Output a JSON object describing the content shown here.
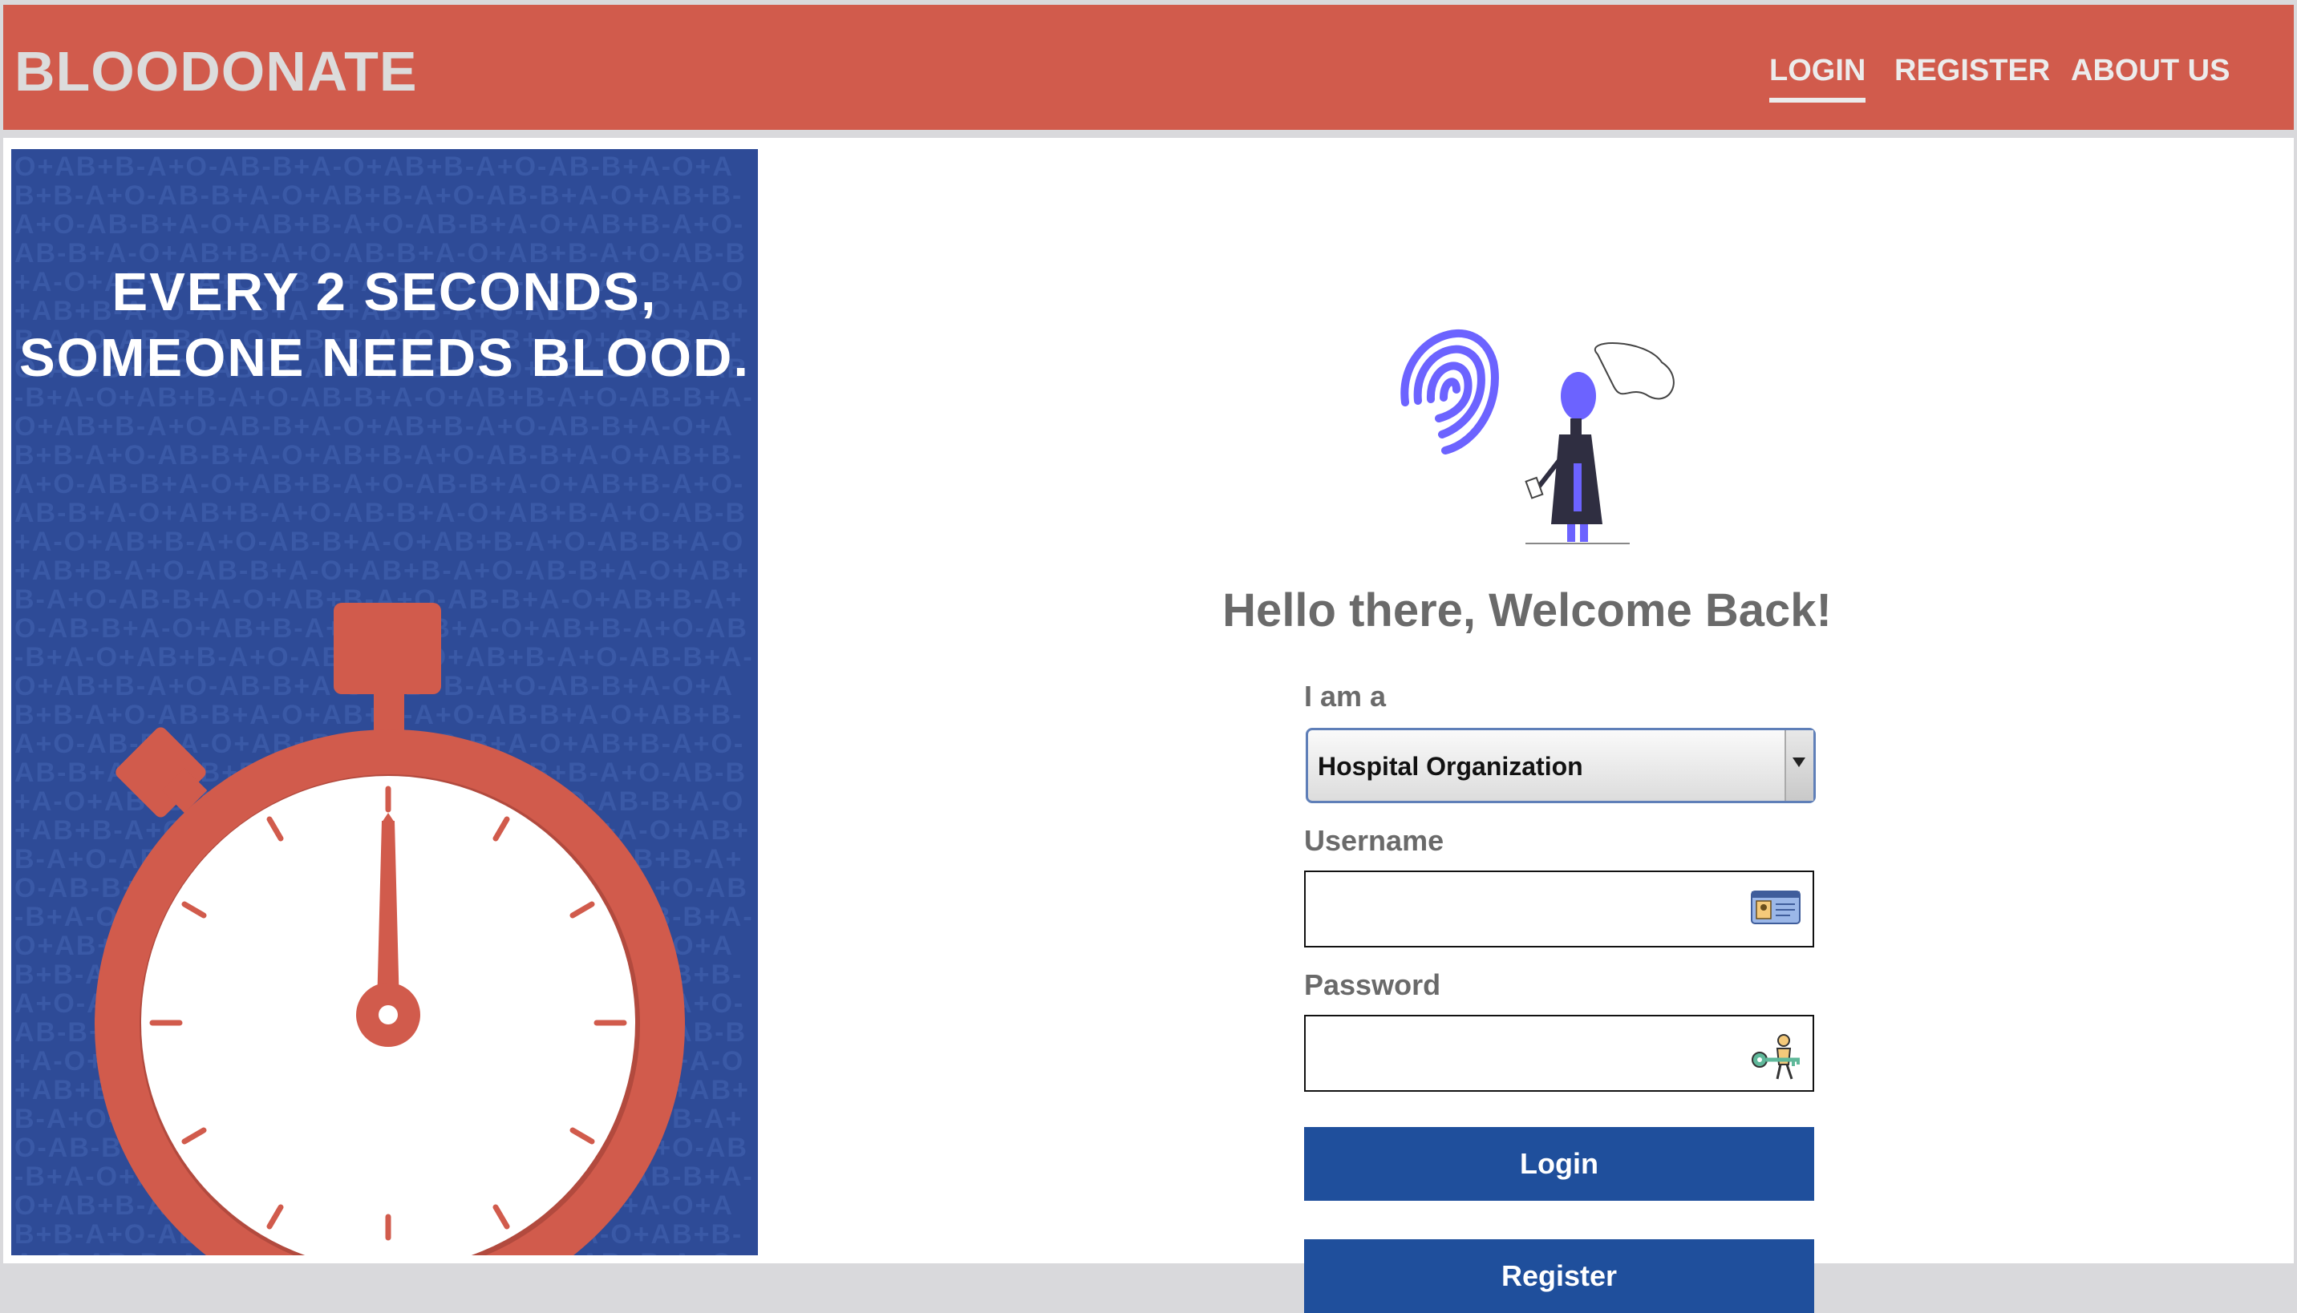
{
  "navbar": {
    "brand": "BLOODONATE",
    "links": [
      {
        "label": "LOGIN",
        "active": true
      },
      {
        "label": "REGISTER",
        "active": false
      },
      {
        "label": "ABOUT US",
        "active": false
      }
    ],
    "bg_color": "#d15b4c"
  },
  "poster": {
    "line1": "EVERY 2 SECONDS,",
    "line2": "SOMEONE NEEDS BLOOD.",
    "pattern_text": "O+AB+B-A+O-AB-B+A-O+AB+B-A+O-AB-B+A-O+AB+B-A+O-AB-B+A-O+AB+B-A+O-AB-B+A-O+AB+B-A+O-AB-B+A-O+AB+B-A+O-AB-B+A-O+AB+B-A+O-AB-B+A-O+AB+B-A+O-AB-B+A-O+AB+B-A+O-AB-B+A-O+AB+B-A+O-AB-B+A-O+AB+B-A+O-AB-B+A-O+AB+B-A+O-AB-B+A-O+AB+B-A+O-AB-B+A-O+AB+B-A+O-AB-B+A-O+AB+B-A+O-AB-B+A-O+AB+B-A+O-AB-B+A-O+AB+B-A+O-AB-B+A-O+AB+B-A+O-AB-B+A-O+AB+B-A+O-AB-B+A-O+AB+B-A+O-AB-B+A-O+AB+B-A+O-AB-B+A-O+AB+B-A+O-AB-B+A-O+AB+B-A+O-AB-B+A-O+AB+B-A+O-AB-B+A-O+AB+B-A+O-AB-B+A-O+AB+B-A+O-AB-B+A-O+AB+B-A+O-AB-B+A-O+AB+B-A+O-AB-B+A-O+AB+B-A+O-AB-B+A-O+AB+B-A+O-AB-B+A-O+AB+B-A+O-AB-B+A-O+AB+B-A+O-AB-B+A-O+AB+B-A+O-AB-B+A-O+AB+B-A+O-AB-B+A-O+AB+B-A+O-AB-B+A-O+AB+B-A+O-AB-B+A-O+AB+B-A+O-AB-B+A-O+AB+B-A+O-AB-B+A-O+AB+B-A+O-AB-B+A-O+AB+B-A+O-AB-B+A-O+AB+B-A+O-AB-B+A-O+AB+B-A+O-AB-B+A-O+AB+B-A+O-AB-B+A-O+AB+B-A+O-AB-B+A-O+AB+B-A+O-AB-B+A-O+AB+B-A+O-AB-B+A-O+AB+B-A+O-AB-B+A-O+AB+B-A+O-AB-B+A-O+AB+B-A+O-AB-B+A-O+AB+B-A+O-AB-B+A-O+AB+B-A+O-AB-B+A-O+AB+B-A+O-AB-B+A-O+AB+B-A+O-AB-B+A-O+AB+B-A+O-AB-B+A-O+AB+B-A+O-AB-B+A-O+AB+B-A+O-AB-B+A-O+AB+B-A+O-AB-B+A-O+AB+B-A+O-AB-B+A-O+AB+B-A+O-AB-B+A-O+AB+B-A+O-AB-B+A-O+AB+B-A+O-AB-B+A-O+AB+B-A+O-AB-B+A-O+AB+B-A+O-AB-B+A-O+AB+B-A+O-AB-B+A-O+AB+B-A+O-AB-B+A-O+AB+B-A+O-AB-B+A-O+AB+B-A+O-AB-B+A-O+AB+B-A+O-AB-B+A-O+AB+B-A+O-AB-B+A-O+AB+B-A+O-AB-B+A-O+AB+B-A+O-AB-B+A-O+AB+B-A+O-AB-B+A-O+AB+B-A+O-AB-B+A-O+AB+B-A+O-AB-B+A-O+AB+B-A+O-AB-B+A-O+AB+B-A+O-AB-B+A-O+AB+B-A+O-AB-B+A-O+AB+B-A+O-AB-B+A-O+AB+B-A+O-AB-B+A-O+AB+B-A+O-AB-B+A-O+AB+B-A+O-AB-B+A-O+AB+B-A+O-AB-B+A-O+AB+B-A+O-AB-B+A-O+AB+B-A+O-AB-B+A-O+AB+B-A+O-AB-B+A-O+AB+B-A+O-AB-B+A-O+AB+B-A+O-AB-B+A-O+AB+B-A+O-AB-B+A-O+AB+B-A+O-AB-B+A-O+AB+B-A+O-AB-B+A-",
    "bg_color": "#2e4b97",
    "accent_color": "#d15b4c"
  },
  "form": {
    "welcome": "Hello there, Welcome Back!",
    "role_label": "I am a",
    "role_selected": "Hospital Organization",
    "username_label": "Username",
    "username_icon": "id-card-icon",
    "password_label": "Password",
    "password_icon": "person-with-key-icon",
    "login_button": "Login",
    "register_button": "Register",
    "button_color": "#1f4f9c"
  }
}
